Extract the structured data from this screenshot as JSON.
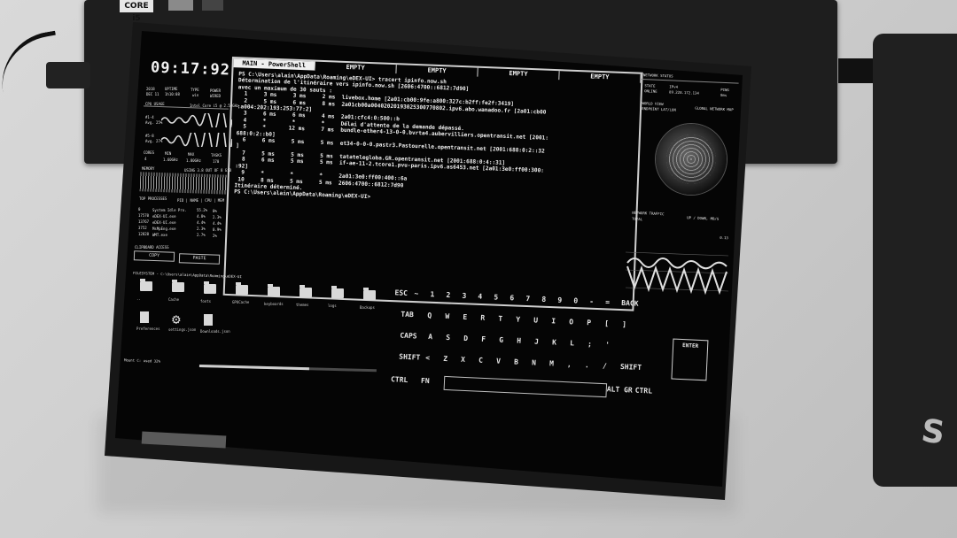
{
  "clock": "09:17:92",
  "status": {
    "year": "2018",
    "date": "DEC 11",
    "uptime_label": "UPTIME",
    "uptime": "1h10:08",
    "type_label": "TYPE",
    "type": "win",
    "power_label": "POWER",
    "power": "WIRED"
  },
  "cpu": {
    "title": "CPU USAGE",
    "model": "Intel Core i5 @ 2.50GHz",
    "core1": "#1-4",
    "core1_avg": "Avg. 25%",
    "core2": "#5-8",
    "core2_avg": "Avg. 27%",
    "temp_labels": [
      "CORES",
      "MIN",
      "MAX",
      "TASKS"
    ],
    "temp_values": [
      "4",
      "1.60GHz",
      "1.80GHz",
      "170"
    ]
  },
  "memory": {
    "title": "MEMORY",
    "detail": "USING 3.8 OUT OF 8 GiB"
  },
  "processes": {
    "title": "TOP PROCESSES",
    "cols": "PID | NAME | CPU | MEM",
    "rows": [
      [
        "0",
        "System Idle Pro.",
        "55.2%",
        "0%"
      ],
      [
        "17570",
        "eDEX-UI.exe",
        "4.8%",
        "2.3%"
      ],
      [
        "13767",
        "eDEX-UI.exe",
        "4.4%",
        "4.4%"
      ],
      [
        "3752",
        "MsMpEng.exe",
        "2.3%",
        "0.9%"
      ],
      [
        "12828",
        "WMT.exe",
        "2.7%",
        "2%"
      ]
    ]
  },
  "clipboard": {
    "title": "CLIPBOARD ACCESS",
    "copy_label": "COPY",
    "paste_label": "PASTE"
  },
  "terminal": {
    "tabs": [
      "MAIN - PowerShell",
      "EMPTY",
      "EMPTY",
      "EMPTY",
      "EMPTY"
    ],
    "lines": [
      "PS C:\\Users\\alain\\AppData\\Roaming\\eDEX-UI> tracert ipinfo.now.sh",
      "",
      "Détermination de l'itinéraire vers ipinfo.now.sh [2606:4700::6812:7d90]",
      "avec un maximum de 30 sauts :",
      "",
      "  1     3 ms     3 ms     2 ms  livebox.home [2a01:cb00:9fe:a800:327c:b2ff:fe2f:3419]",
      "  2     5 ms     6 ms     8 ms  2a01cb00a00402020193025300770802.ipv6.abo.wanadoo.fr [2a01:cb00",
      ":a004:202:193:253:77:2]",
      "  3     6 ms     6 ms     4 ms  2a01:cfc4:0:500::b",
      "  4     *        *        *     Délai d'attente de la demande dépassé.",
      "  5     *       12 ms     7 ms  bundle-ether4-13-0-0.bvrta4.aubervilliers.opentransit.net [2001:",
      "688:0:2::b0]",
      "  6     6 ms     5 ms     5 ms  et34-0-0-0.pastr3.Pastourelle.opentransit.net [2001:688:0:2::32",
      "]",
      "  7     5 ms     5 ms     5 ms  tatatelegloba.GR.opentransit.net [2001:688:0:4::31]",
      "  8     6 ms     5 ms     5 ms  if-ae-11-2.tcore1.pvu-paris.ipv6.as6453.net [2a01:3e0:ff00:300:",
      ":92]",
      "  9     *        *        *     2a01:3e0:ff00:400::6a",
      " 10     8 ms     5 ms     5 ms  2606:4700::6812:7d90",
      "",
      "Itinéraire déterminé.",
      "PS C:\\Users\\alain\\AppData\\Roaming\\eDEX-UI>"
    ]
  },
  "network": {
    "title": "NETWORK STATUS",
    "state_label": "STATE",
    "state": "ONLINE",
    "ip_label": "IPv4",
    "ip": "89.228.172.134",
    "ping_label": "PING",
    "ping": "8ms",
    "world_title": "WORLD VIEW",
    "world_sub": "GLOBAL NETWORK MAP",
    "endpoint": "ENDPOINT LAT/LON",
    "traffic_title": "NETWORK TRAFFIC",
    "traffic_detail": "UP / DOWN, MB/S",
    "traffic_total": "TOTAL",
    "traffic_scale": "0.13"
  },
  "filesystem": {
    "title": "FILESYSTEM - C:\\Users\\alain\\AppData\\Roaming\\eDEX-UI",
    "items": [
      "..",
      "Cache",
      "fonts",
      "GPUCache",
      "keyboards",
      "themes",
      "logs",
      "Backups",
      "Preferences",
      "settings.json",
      "Downloads.json"
    ],
    "mount_label": "Mount C: used 32%",
    "usage_fraction": 0.62
  },
  "keyboard": {
    "row0": [
      "ESC",
      "~",
      "1",
      "2",
      "3",
      "4",
      "5",
      "6",
      "7",
      "8",
      "9",
      "0",
      "-",
      "=",
      "BACK"
    ],
    "row1": [
      "TAB",
      "Q",
      "W",
      "E",
      "R",
      "T",
      "Y",
      "U",
      "I",
      "O",
      "P",
      "[",
      "]"
    ],
    "row2": [
      "CAPS",
      "A",
      "S",
      "D",
      "F",
      "G",
      "H",
      "J",
      "K",
      "L",
      ";",
      "'"
    ],
    "row3": [
      "SHIFT",
      "<",
      "Z",
      "X",
      "C",
      "V",
      "B",
      "N",
      "M",
      ",",
      ".",
      "/",
      "SHIFT"
    ],
    "row4": [
      "CTRL",
      "FN",
      "ALT GR",
      "CTRL"
    ],
    "enter_label": "ENTER"
  },
  "device_sticker": "CORE i5",
  "device_mark": "S"
}
